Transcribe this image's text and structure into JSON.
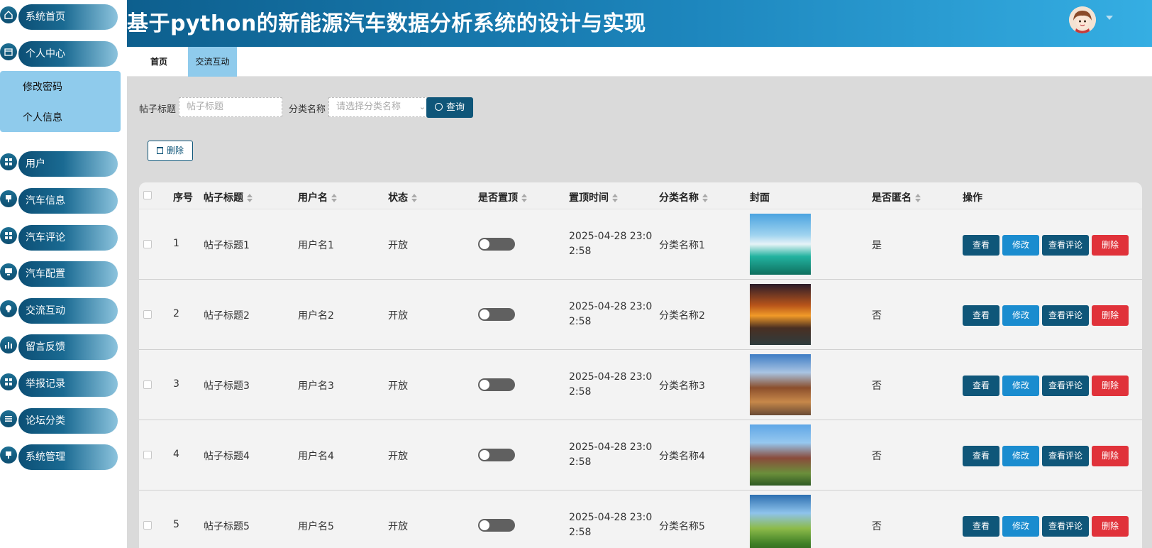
{
  "header": {
    "title": "基于python的新能源汽车数据分析系统的设计与实现"
  },
  "sidebar": {
    "items": [
      {
        "label": "系统首页",
        "icon": "home-icon"
      },
      {
        "label": "个人中心",
        "icon": "calendar-icon"
      },
      {
        "label": "用户",
        "icon": "grid-icon"
      },
      {
        "label": "汽车信息",
        "icon": "pin-icon"
      },
      {
        "label": "汽车评论",
        "icon": "grid-icon"
      },
      {
        "label": "汽车配置",
        "icon": "monitor-icon"
      },
      {
        "label": "交流互动",
        "icon": "bulb-icon"
      },
      {
        "label": "留言反馈",
        "icon": "bar-chart-icon"
      },
      {
        "label": "举报记录",
        "icon": "grid-icon"
      },
      {
        "label": "论坛分类",
        "icon": "list-icon"
      },
      {
        "label": "系统管理",
        "icon": "pin-icon"
      }
    ],
    "submenu": [
      "修改密码",
      "个人信息"
    ]
  },
  "tabs": [
    "首页",
    "交流互动"
  ],
  "search": {
    "title_label": "帖子标题",
    "title_placeholder": "帖子标题",
    "category_label": "分类名称",
    "category_placeholder": "请选择分类名称",
    "search_button": "查询"
  },
  "toolbar": {
    "delete_button": "删除"
  },
  "table": {
    "headers": [
      "序号",
      "帖子标题",
      "用户名",
      "状态",
      "是否置顶",
      "置顶时间",
      "分类名称",
      "封面",
      "是否匿名",
      "操作"
    ],
    "actions": [
      "查看",
      "修改",
      "查看评论",
      "删除"
    ],
    "rows": [
      {
        "index": "1",
        "title": "帖子标题1",
        "user": "用户名1",
        "status": "开放",
        "time": "2025-04-28 23:02:58",
        "category": "分类名称1",
        "anonymous": "是"
      },
      {
        "index": "2",
        "title": "帖子标题2",
        "user": "用户名2",
        "status": "开放",
        "time": "2025-04-28 23:02:58",
        "category": "分类名称2",
        "anonymous": "否"
      },
      {
        "index": "3",
        "title": "帖子标题3",
        "user": "用户名3",
        "status": "开放",
        "time": "2025-04-28 23:02:58",
        "category": "分类名称3",
        "anonymous": "否"
      },
      {
        "index": "4",
        "title": "帖子标题4",
        "user": "用户名4",
        "status": "开放",
        "time": "2025-04-28 23:02:58",
        "category": "分类名称4",
        "anonymous": "否"
      },
      {
        "index": "5",
        "title": "帖子标题5",
        "user": "用户名5",
        "status": "开放",
        "time": "2025-04-28 23:02:58",
        "category": "分类名称5",
        "anonymous": "否"
      }
    ]
  }
}
